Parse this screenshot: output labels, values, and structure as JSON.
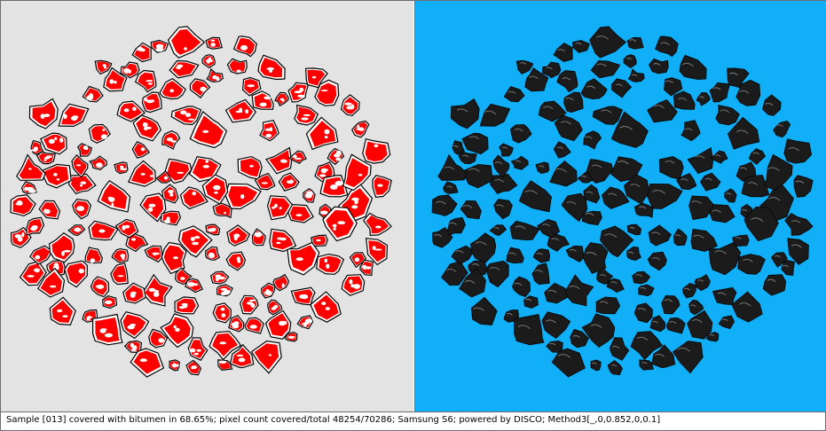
{
  "colors": {
    "left_background": "#e3e3e3",
    "right_background": "#10aff7",
    "covered_marker": "#ff0000",
    "uncovered_area": "#ffffff",
    "particle_outline": "#000000",
    "particle_body": "#1b1b1b",
    "particle_highlight": "#9c9c9c"
  },
  "panels": {
    "left": {
      "view": "coverage-mask"
    },
    "right": {
      "view": "original-photo"
    }
  },
  "status": {
    "text": "Sample [013] covered with bitumen in 68.65%; pixel count covered/total 48254/70286; Samsung S6; powered by DISCO; Method3[_,0,0.852,0,0.1]"
  },
  "measurements": {
    "coverage_percent": 68.65,
    "pixels_covered": 48254,
    "pixels_total": 70286
  }
}
